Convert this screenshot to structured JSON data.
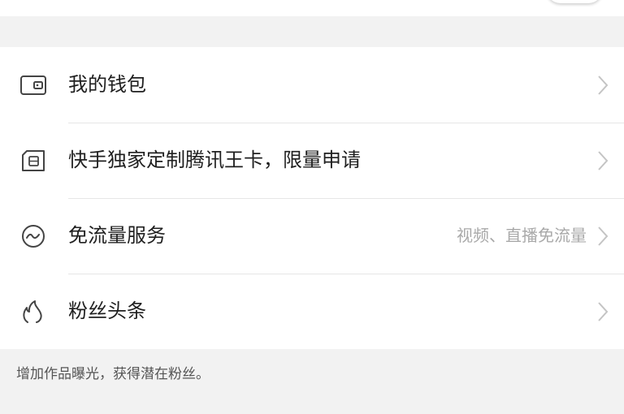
{
  "menu": {
    "items": [
      {
        "label": "我的钱包",
        "hint": "",
        "icon": "wallet-icon"
      },
      {
        "label": "快手独家定制腾讯王卡，限量申请",
        "hint": "",
        "icon": "sim-card-icon"
      },
      {
        "label": "免流量服务",
        "hint": "视频、直播免流量",
        "icon": "data-wave-icon"
      },
      {
        "label": "粉丝头条",
        "hint": "",
        "icon": "flame-icon"
      }
    ]
  },
  "footer": {
    "note": "增加作品曝光，获得潜在粉丝。"
  },
  "colors": {
    "background": "#f2f2f2",
    "card": "#ffffff",
    "text_primary": "#1f1f1f",
    "text_hint": "#a9a9a9",
    "icon_stroke": "#444444",
    "chevron": "#c4c4c4"
  }
}
